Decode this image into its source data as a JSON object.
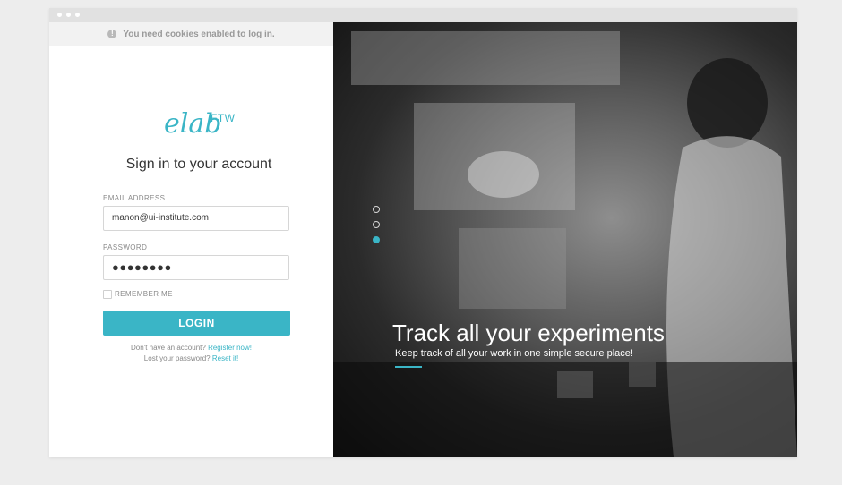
{
  "cookie_notice": {
    "text": "You need cookies enabled to log in.",
    "icon": "info-icon"
  },
  "logo": {
    "text": "elab",
    "superscript": "FTW"
  },
  "heading": "Sign in to your account",
  "email": {
    "label": "EMAIL ADDRESS",
    "value": "manon@ui-institute.com"
  },
  "password": {
    "label": "PASSWORD",
    "value": "●●●●●●●●"
  },
  "remember": {
    "label": "REMEMBER ME",
    "checked": false
  },
  "login_button": "LOGIN",
  "register": {
    "prompt": "Don't have an account?",
    "link": "Register now!"
  },
  "reset": {
    "prompt": "Lost your password?",
    "link": "Reset it!"
  },
  "slide": {
    "title": "Track all your experiments",
    "subtitle": "Keep track of all your work in one simple secure place!",
    "total": 3,
    "active_index": 2
  },
  "colors": {
    "accent": "#3ab5c6"
  }
}
